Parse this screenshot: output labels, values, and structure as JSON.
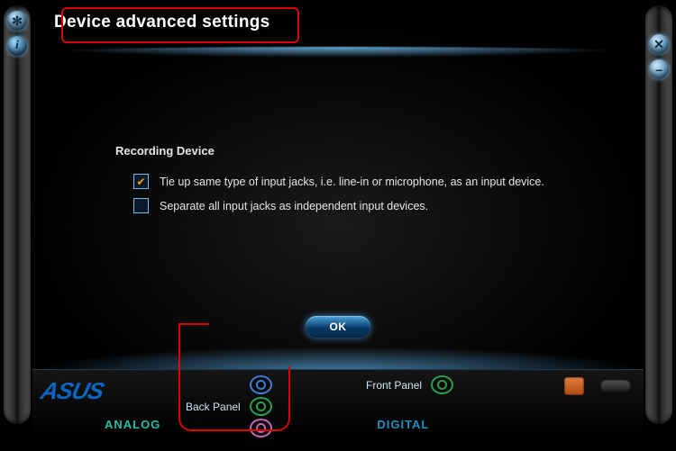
{
  "header": {
    "title": "Device advanced settings"
  },
  "leftOrbs": {
    "gear": "settings-icon",
    "info": "info-icon"
  },
  "rightOrbs": {
    "close": "close-icon",
    "min": "minimize-icon"
  },
  "recording": {
    "section_title": "Recording Device",
    "options": [
      {
        "label": "Tie up same type of input jacks, i.e. line-in or microphone, as an input device.",
        "checked": true
      },
      {
        "label": "Separate all input jacks as independent input devices.",
        "checked": false
      }
    ]
  },
  "buttons": {
    "ok": "OK"
  },
  "footer": {
    "brand": "ASUS",
    "back_panel_label": "Back Panel",
    "front_panel_label": "Front Panel",
    "back_jacks": [
      "blue",
      "green",
      "pink"
    ],
    "front_jacks": [
      "green"
    ],
    "tabs": {
      "analog": "ANALOG",
      "digital": "DIGITAL"
    }
  }
}
